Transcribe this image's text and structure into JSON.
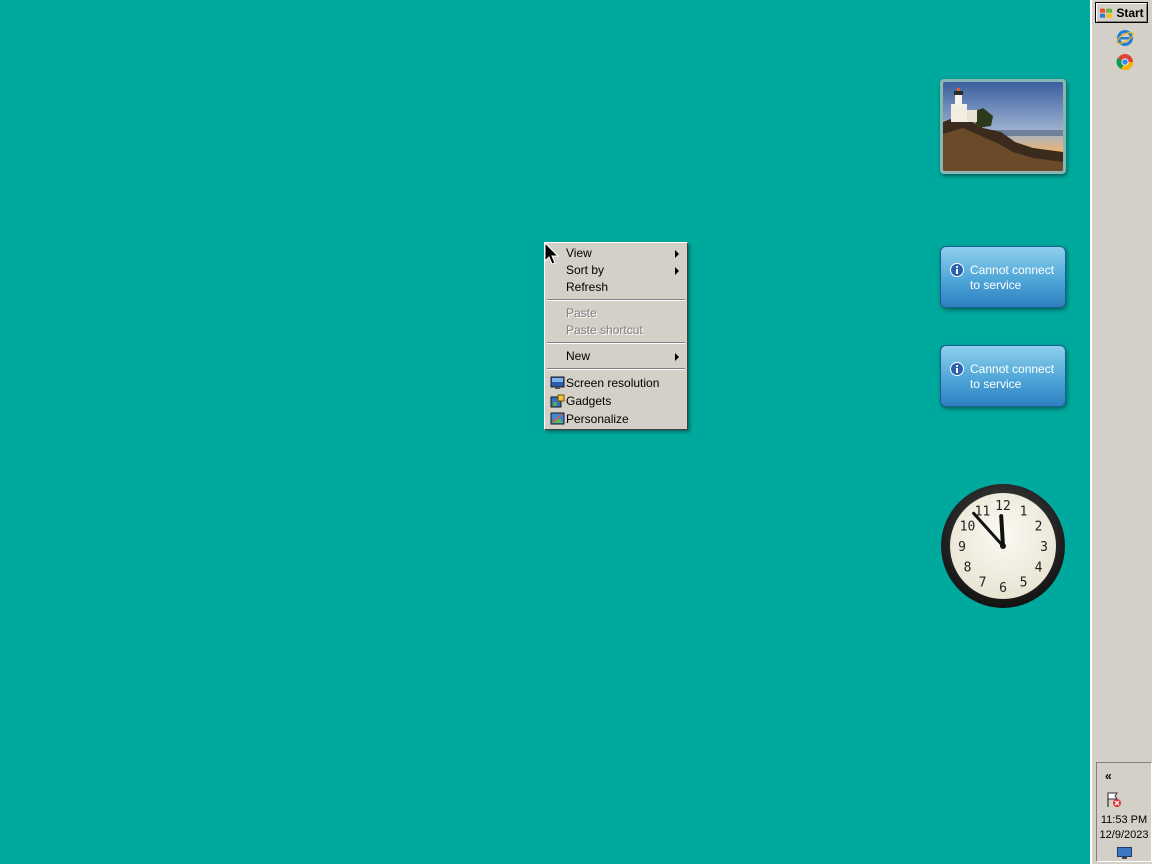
{
  "taskbar": {
    "start_label": "Start",
    "quick_launch": [
      {
        "icon": "internet-explorer-icon"
      },
      {
        "icon": "chrome-icon"
      }
    ],
    "tray": {
      "expand_label": "«",
      "time": "11:53 PM",
      "date": "12/9/2023"
    }
  },
  "gadgets": {
    "weather_1": {
      "message": "Cannot connect to service"
    },
    "weather_2": {
      "message": "Cannot connect to service"
    },
    "clock": {
      "numbers": [
        "12",
        "1",
        "2",
        "3",
        "4",
        "5",
        "6",
        "7",
        "8",
        "9",
        "10",
        "11"
      ],
      "hour": 11,
      "minute": 53
    }
  },
  "context_menu": {
    "items": [
      {
        "label": "View",
        "submenu": true,
        "enabled": true
      },
      {
        "label": "Sort by",
        "submenu": true,
        "enabled": true
      },
      {
        "label": "Refresh",
        "submenu": false,
        "enabled": true
      },
      {
        "label": "Paste",
        "submenu": false,
        "enabled": false
      },
      {
        "label": "Paste shortcut",
        "submenu": false,
        "enabled": false
      },
      {
        "label": "New",
        "submenu": true,
        "enabled": true
      },
      {
        "label": "Screen resolution",
        "icon": "screen-resolution-icon",
        "enabled": true
      },
      {
        "label": "Gadgets",
        "icon": "gadgets-icon",
        "enabled": true
      },
      {
        "label": "Personalize",
        "icon": "personalize-icon",
        "enabled": true
      }
    ]
  },
  "colors": {
    "desktop": "#00a99d",
    "taskbar": "#d4d0c8",
    "menu": "#d4d0c8"
  }
}
